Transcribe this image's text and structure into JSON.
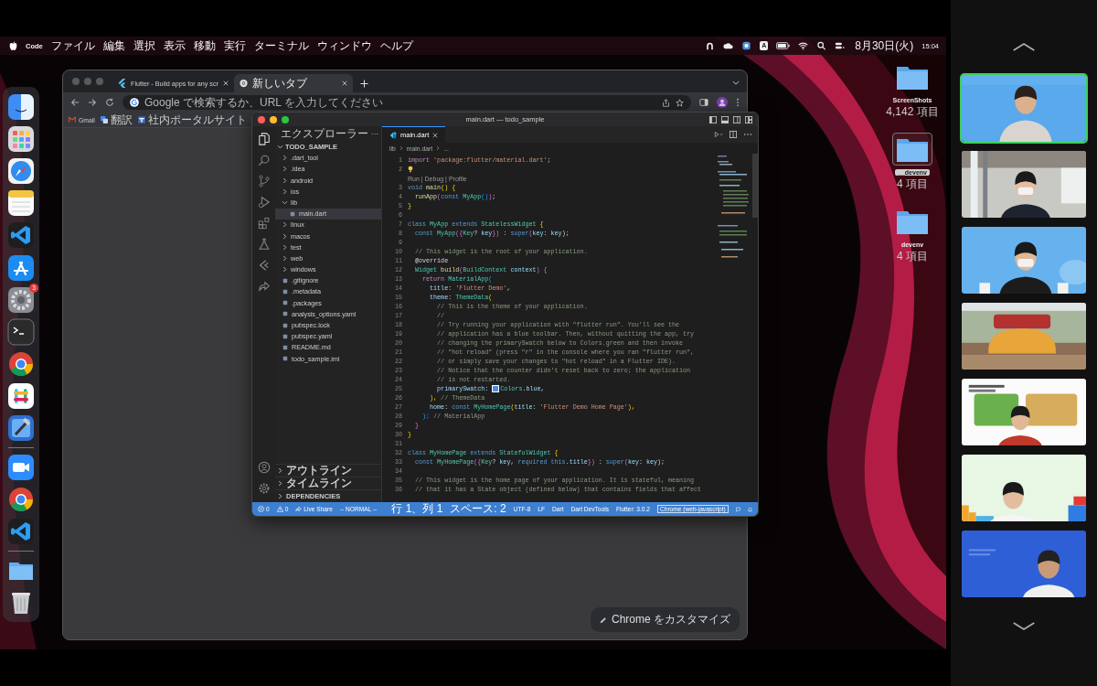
{
  "menu_bar": {
    "app": "Code",
    "menus": [
      "ファイル",
      "編集",
      "選択",
      "表示",
      "移動",
      "実行",
      "ターミナル",
      "ウィンドウ",
      "ヘルプ"
    ],
    "input_source": "A",
    "date": "8月30日(火)",
    "time": "15:04"
  },
  "dock": [
    {
      "kind": "finder"
    },
    {
      "kind": "launchpad"
    },
    {
      "kind": "safari"
    },
    {
      "kind": "notes"
    },
    {
      "kind": "vscode"
    },
    {
      "kind": "appstore"
    },
    {
      "kind": "settings",
      "badge": "3"
    },
    {
      "kind": "terminal"
    },
    {
      "kind": "chrome"
    },
    {
      "kind": "slack"
    },
    {
      "kind": "xcode"
    },
    {
      "kind": "separator"
    },
    {
      "kind": "zoom"
    },
    {
      "kind": "chrome"
    },
    {
      "kind": "vscode"
    },
    {
      "kind": "separator"
    },
    {
      "kind": "folder"
    },
    {
      "kind": "trash"
    }
  ],
  "desktop_icons": [
    {
      "label": "ScreenShots",
      "detail": "4,142 項目",
      "selected": false
    },
    {
      "label": "__devenv",
      "detail": "4 項目",
      "selected": true
    },
    {
      "label": "devenv",
      "detail": "4 項目",
      "selected": false
    }
  ],
  "browser": {
    "tabs": [
      {
        "title": "Flutter - Build apps for any scr",
        "kind": "flutter",
        "selected": false
      },
      {
        "title": "新しいタブ",
        "kind": "chrome",
        "selected": true
      }
    ],
    "omnibox": {
      "placeholder": "Google で検索するか、URL を入力してください"
    },
    "bookmarks": [
      {
        "label": "Gmail",
        "kind": "mail"
      },
      {
        "label": "翻訳",
        "kind": "translate"
      },
      {
        "label": "社内ポータルサイト",
        "kind": "page"
      }
    ],
    "customize_button": "Chrome をカスタマイズ"
  },
  "vscode": {
    "title": "main.dart — todo_sample",
    "explorer": {
      "title": "エクスプローラー",
      "root": {
        "label": "TODO_SAMPLE",
        "expanded": true,
        "children": [
          {
            "label": ".dart_tool",
            "kind": "folder",
            "expanded": false,
            "selected": false
          },
          {
            "label": ".idea",
            "kind": "folder",
            "expanded": false,
            "selected": false
          },
          {
            "label": "android",
            "kind": "folder",
            "expanded": false,
            "selected": false
          },
          {
            "label": "ios",
            "kind": "folder",
            "expanded": false,
            "selected": false
          },
          {
            "label": "lib",
            "kind": "folder",
            "expanded": true,
            "selected": false,
            "children": [
              {
                "label": "main.dart",
                "kind": "file",
                "selected": true
              }
            ]
          },
          {
            "label": "linux",
            "kind": "folder",
            "expanded": false,
            "selected": false
          },
          {
            "label": "macos",
            "kind": "folder",
            "expanded": false,
            "selected": false
          },
          {
            "label": "test",
            "kind": "folder",
            "expanded": false,
            "selected": false
          },
          {
            "label": "web",
            "kind": "folder",
            "expanded": false,
            "selected": false
          },
          {
            "label": "windows",
            "kind": "folder",
            "expanded": false,
            "selected": false
          },
          {
            "label": ".gitignore",
            "kind": "file",
            "selected": false
          },
          {
            "label": ".metadata",
            "kind": "file",
            "selected": false
          },
          {
            "label": ".packages",
            "kind": "file",
            "selected": false
          },
          {
            "label": "analysis_options.yaml",
            "kind": "file",
            "selected": false
          },
          {
            "label": "pubspec.lock",
            "kind": "file",
            "selected": false
          },
          {
            "label": "pubspec.yaml",
            "kind": "file",
            "selected": false
          },
          {
            "label": "README.md",
            "kind": "file",
            "selected": false
          },
          {
            "label": "todo_sample.iml",
            "kind": "file",
            "selected": false
          }
        ]
      },
      "sections": [
        {
          "label": "アウトライン",
          "expanded": false
        },
        {
          "label": "タイムライン",
          "expanded": false
        },
        {
          "label": "DEPENDENCIES",
          "expanded": false
        }
      ]
    },
    "editor": {
      "tabs": [
        {
          "label": "main.dart",
          "selected": true
        }
      ],
      "breadcrumb": [
        "lib",
        "main.dart",
        "..."
      ],
      "lines": [
        {
          "n": "1",
          "tokens": [
            {
              "t": "import",
              "kind": "ctrl"
            },
            {
              "t": " 'package:flutter/material.dart'",
              "kind": "str"
            },
            {
              "t": ";",
              "kind": "p"
            }
          ]
        },
        {
          "n": "2",
          "lightbulb": true
        },
        {
          "codelens": "Run | Debug | Profile"
        },
        {
          "n": "3",
          "tokens": [
            {
              "t": "void",
              "kind": "kw"
            },
            {
              "t": " main",
              "kind": "fn"
            },
            {
              "t": "() {",
              "kind": "br"
            }
          ]
        },
        {
          "n": "4",
          "tokens": [
            {
              "t": "  runApp",
              "kind": "fn"
            },
            {
              "t": "(",
              "kind": "br2"
            },
            {
              "t": "const",
              "kind": "kw"
            },
            {
              "t": " MyApp",
              "kind": "cls"
            },
            {
              "t": "()",
              "kind": "br3"
            },
            {
              "t": ")",
              "kind": "br2"
            },
            {
              "t": ";",
              "kind": "p"
            }
          ]
        },
        {
          "n": "5",
          "tokens": [
            {
              "t": "}",
              "kind": "br"
            }
          ]
        },
        {
          "n": "6"
        },
        {
          "n": "7",
          "tokens": [
            {
              "t": "class",
              "kind": "kw"
            },
            {
              "t": " MyApp",
              "kind": "cls"
            },
            {
              "t": " extends",
              "kind": "kw"
            },
            {
              "t": " StatelessWidget",
              "kind": "cls"
            },
            {
              "t": " {",
              "kind": "br"
            }
          ]
        },
        {
          "n": "8",
          "tokens": [
            {
              "t": "  const",
              "kind": "kw"
            },
            {
              "t": " MyApp",
              "kind": "cls"
            },
            {
              "t": "({",
              "kind": "br2"
            },
            {
              "t": "Key",
              "kind": "cls"
            },
            {
              "t": "? ",
              "kind": "p"
            },
            {
              "t": "key",
              "kind": "var"
            },
            {
              "t": "})",
              "kind": "br2"
            },
            {
              "t": " : ",
              "kind": "p"
            },
            {
              "t": "super",
              "kind": "kw"
            },
            {
              "t": "(",
              "kind": "br2"
            },
            {
              "t": "key",
              "kind": "var"
            },
            {
              "t": ": ",
              "kind": "p"
            },
            {
              "t": "key",
              "kind": "var"
            },
            {
              "t": ");",
              "kind": "p"
            }
          ]
        },
        {
          "n": "9"
        },
        {
          "n": "10",
          "tokens": [
            {
              "t": "  // This widget is the root of your application.",
              "kind": "cm"
            }
          ]
        },
        {
          "n": "11",
          "tokens": [
            {
              "t": "  @override",
              "kind": "p"
            }
          ]
        },
        {
          "n": "12",
          "tokens": [
            {
              "t": "  Widget",
              "kind": "cls"
            },
            {
              "t": " build",
              "kind": "fn"
            },
            {
              "t": "(",
              "kind": "br2"
            },
            {
              "t": "BuildContext",
              "kind": "cls"
            },
            {
              "t": " context",
              "kind": "var"
            },
            {
              "t": ") {",
              "kind": "br2"
            }
          ]
        },
        {
          "n": "13",
          "tokens": [
            {
              "t": "    return",
              "kind": "ctrl"
            },
            {
              "t": " MaterialApp",
              "kind": "cls"
            },
            {
              "t": "(",
              "kind": "br3"
            }
          ]
        },
        {
          "n": "14",
          "tokens": [
            {
              "t": "      title",
              "kind": "var"
            },
            {
              "t": ": ",
              "kind": "p"
            },
            {
              "t": "'Flutter Demo'",
              "kind": "str"
            },
            {
              "t": ",",
              "kind": "p"
            }
          ]
        },
        {
          "n": "15",
          "tokens": [
            {
              "t": "      theme",
              "kind": "var"
            },
            {
              "t": ": ",
              "kind": "p"
            },
            {
              "t": "ThemeData",
              "kind": "cls"
            },
            {
              "t": "(",
              "kind": "br"
            }
          ]
        },
        {
          "n": "16",
          "tokens": [
            {
              "t": "        // This is the theme of your application.",
              "kind": "cm"
            }
          ]
        },
        {
          "n": "17",
          "tokens": [
            {
              "t": "        //",
              "kind": "cm"
            }
          ]
        },
        {
          "n": "18",
          "tokens": [
            {
              "t": "        // Try running your application with \"flutter run\". You'll see the",
              "kind": "cm"
            }
          ]
        },
        {
          "n": "19",
          "tokens": [
            {
              "t": "        // application has a blue toolbar. Then, without quitting the app, try",
              "kind": "cm"
            }
          ]
        },
        {
          "n": "20",
          "tokens": [
            {
              "t": "        // changing the primarySwatch below to Colors.green and then invoke",
              "kind": "cm"
            }
          ]
        },
        {
          "n": "21",
          "tokens": [
            {
              "t": "        // \"hot reload\" (press \"r\" in the console where you ran \"flutter run\",",
              "kind": "cm"
            }
          ]
        },
        {
          "n": "22",
          "tokens": [
            {
              "t": "        // or simply save your changes to \"hot reload\" in a Flutter IDE).",
              "kind": "cm"
            }
          ]
        },
        {
          "n": "23",
          "tokens": [
            {
              "t": "        // Notice that the counter didn't reset back to zero; the application",
              "kind": "cm"
            }
          ]
        },
        {
          "n": "24",
          "tokens": [
            {
              "t": "        // is not restarted.",
              "kind": "cm"
            }
          ]
        },
        {
          "n": "25",
          "tokens": [
            {
              "t": "        primarySwatch",
              "kind": "var"
            },
            {
              "t": ": ",
              "kind": "p"
            },
            {
              "kind": "swatch",
              "color": "#4a8fe7"
            },
            {
              "t": "Colors",
              "kind": "cls"
            },
            {
              "t": ".",
              "kind": "p"
            },
            {
              "t": "blue",
              "kind": "var"
            },
            {
              "t": ",",
              "kind": "p"
            }
          ]
        },
        {
          "n": "26",
          "tokens": [
            {
              "t": "      ),",
              "kind": "br"
            },
            {
              "t": " // ThemeData",
              "kind": "cm"
            }
          ]
        },
        {
          "n": "27",
          "tokens": [
            {
              "t": "      home",
              "kind": "var"
            },
            {
              "t": ": ",
              "kind": "p"
            },
            {
              "t": "const",
              "kind": "kw"
            },
            {
              "t": " MyHomePage",
              "kind": "cls"
            },
            {
              "t": "(",
              "kind": "br"
            },
            {
              "t": "title",
              "kind": "var"
            },
            {
              "t": ": ",
              "kind": "p"
            },
            {
              "t": "'Flutter Demo Home Page'",
              "kind": "str"
            },
            {
              "t": "),",
              "kind": "br"
            }
          ]
        },
        {
          "n": "28",
          "tokens": [
            {
              "t": "    );",
              "kind": "br3"
            },
            {
              "t": " // MaterialApp",
              "kind": "cm"
            }
          ]
        },
        {
          "n": "29",
          "tokens": [
            {
              "t": "  }",
              "kind": "br2"
            }
          ]
        },
        {
          "n": "30",
          "tokens": [
            {
              "t": "}",
              "kind": "br"
            }
          ]
        },
        {
          "n": "31"
        },
        {
          "n": "32",
          "tokens": [
            {
              "t": "class",
              "kind": "kw"
            },
            {
              "t": " MyHomePage",
              "kind": "cls"
            },
            {
              "t": " extends",
              "kind": "kw"
            },
            {
              "t": " StatefulWidget",
              "kind": "cls"
            },
            {
              "t": " {",
              "kind": "br"
            }
          ]
        },
        {
          "n": "33",
          "tokens": [
            {
              "t": "  const",
              "kind": "kw"
            },
            {
              "t": " MyHomePage",
              "kind": "cls"
            },
            {
              "t": "({",
              "kind": "br2"
            },
            {
              "t": "Key",
              "kind": "cls"
            },
            {
              "t": "? ",
              "kind": "p"
            },
            {
              "t": "key",
              "kind": "var"
            },
            {
              "t": ", ",
              "kind": "p"
            },
            {
              "t": "required",
              "kind": "kw"
            },
            {
              "t": " this",
              "kind": "kw"
            },
            {
              "t": ".",
              "kind": "p"
            },
            {
              "t": "title",
              "kind": "var"
            },
            {
              "t": "})",
              "kind": "br2"
            },
            {
              "t": " : ",
              "kind": "p"
            },
            {
              "t": "super",
              "kind": "kw"
            },
            {
              "t": "(",
              "kind": "br2"
            },
            {
              "t": "key",
              "kind": "var"
            },
            {
              "t": ": ",
              "kind": "p"
            },
            {
              "t": "key",
              "kind": "var"
            },
            {
              "t": ");",
              "kind": "p"
            }
          ]
        },
        {
          "n": "34"
        },
        {
          "n": "35",
          "tokens": [
            {
              "t": "  // This widget is the home page of your application. It is stateful, meaning",
              "kind": "cm"
            }
          ]
        },
        {
          "n": "36",
          "tokens": [
            {
              "t": "  // that it has a State object (defined below) that contains fields that affect",
              "kind": "cm"
            }
          ]
        }
      ]
    },
    "status_bar": {
      "left": [
        {
          "kind": "errors",
          "text": "0"
        },
        {
          "kind": "warnings",
          "text": "0"
        },
        {
          "kind": "liveshare",
          "text": "Live Share"
        },
        {
          "kind": "plain",
          "text": "-- NORMAL --"
        }
      ],
      "right": [
        {
          "kind": "plain",
          "text": "行 1、列 1"
        },
        {
          "kind": "plain",
          "text": "スペース: 2"
        },
        {
          "kind": "plain",
          "text": "UTF-8"
        },
        {
          "kind": "plain",
          "text": "LF"
        },
        {
          "kind": "plain",
          "text": "Dart"
        },
        {
          "kind": "plain",
          "text": "Dart DevTools"
        },
        {
          "kind": "plain",
          "text": "Flutter: 3.0.2"
        },
        {
          "kind": "device",
          "text": "Chrome (web-javascript)"
        }
      ]
    }
  },
  "participants": [
    {
      "kind": "picture",
      "speaking": true
    },
    {
      "kind": "picture",
      "speaking": false
    },
    {
      "kind": "picture",
      "speaking": false
    },
    {
      "kind": "picture",
      "speaking": false
    },
    {
      "kind": "picture",
      "speaking": false
    },
    {
      "kind": "picture",
      "speaking": false
    },
    {
      "kind": "picture",
      "speaking": false
    }
  ]
}
